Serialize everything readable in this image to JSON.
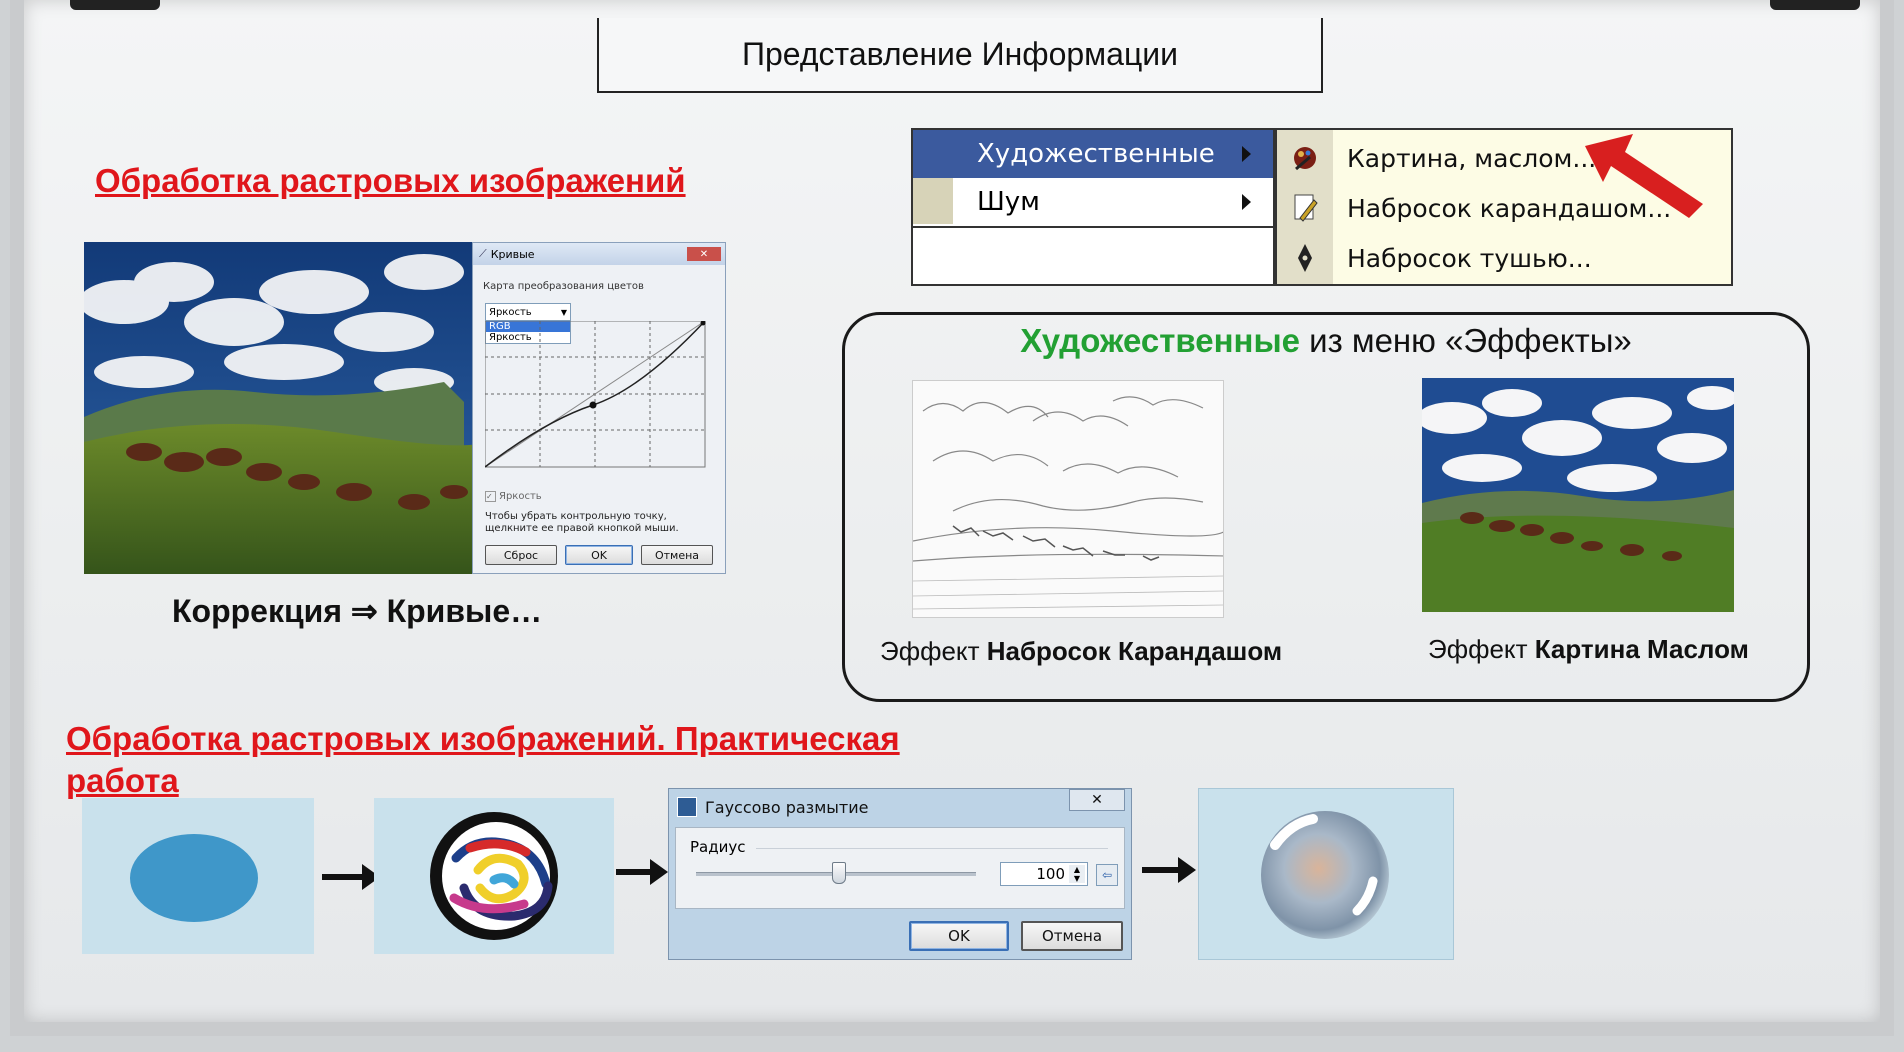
{
  "slide": {
    "title": "Представление Информации",
    "heading1": "Обработка растровых изображений",
    "curves_caption": "Коррекция ⇒ Кривые…",
    "heading2_line1": "Обработка растровых изображений. Практическая",
    "heading2_line2": "работа"
  },
  "curves_dialog": {
    "title": "Кривые",
    "map_label": "Карта преобразования цветов",
    "select_value": "Яркость",
    "options": [
      "RGB",
      "Яркость"
    ],
    "checkbox_label": "Яркость",
    "hint": "Чтобы убрать контрольную точку, щелкните ее правой кнопкой мыши.",
    "reset": "Сброс",
    "ok": "OK",
    "cancel": "Отмена"
  },
  "effects_menu": {
    "items": [
      {
        "label": "Художественные"
      },
      {
        "label": "Шум"
      }
    ],
    "submenu": [
      {
        "label": "Картина, маслом...",
        "icon": "palette-icon"
      },
      {
        "label": "Набросок карандашом...",
        "icon": "pencil-icon"
      },
      {
        "label": "Набросок тушью...",
        "icon": "ink-pen-icon"
      }
    ],
    "highlight_color": "#3b5a9e",
    "arrow_color": "#d81f1f"
  },
  "effects_group": {
    "title_green": "Художественные",
    "title_rest": " из меню «Эффекты»",
    "pencil_prefix": "Эффект ",
    "pencil_bold": "Набросок Карандашом",
    "oil_prefix": "Эффект ",
    "oil_bold": "Картина Маслом"
  },
  "gauss_dialog": {
    "title": "Гауссово размытие",
    "radius_label": "Радиус",
    "radius_value": "100",
    "ok": "OK",
    "cancel": "Отмена"
  },
  "colors": {
    "heading_red": "#e0161b",
    "green": "#22a033",
    "panel_blue": "#c9e1ec",
    "ellipse_blue": "#3f97c9"
  }
}
